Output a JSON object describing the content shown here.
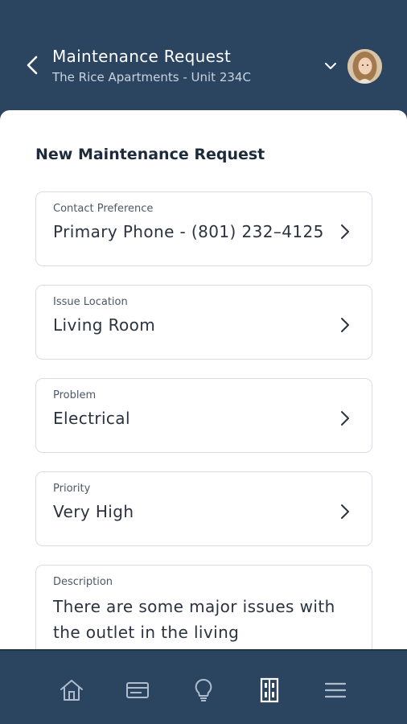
{
  "header": {
    "title": "Maintenance Request",
    "subtitle": "The Rice Apartments - Unit 234C",
    "back_icon": "chevron-left-icon",
    "dropdown_icon": "chevron-down-icon"
  },
  "form": {
    "title": "New Maintenance Request",
    "fields": [
      {
        "label": "Contact Preference",
        "value": "Primary Phone - (801) 232–4125"
      },
      {
        "label": "Issue Location",
        "value": "Living Room"
      },
      {
        "label": "Problem",
        "value": "Electrical"
      },
      {
        "label": "Priority",
        "value": "Very High"
      }
    ],
    "description": {
      "label": "Description",
      "value": "There are some major issues with the outlet in the living"
    }
  },
  "bottom_nav": {
    "items": [
      "home-icon",
      "payment-card-icon",
      "lightbulb-icon",
      "door-icon",
      "menu-icon"
    ],
    "active_index": 3
  },
  "colors": {
    "header_bg": "#2b4560",
    "sheet_bg": "#ffffff",
    "icon_color": "#aebccb",
    "active_icon_color": "#ffffff"
  }
}
